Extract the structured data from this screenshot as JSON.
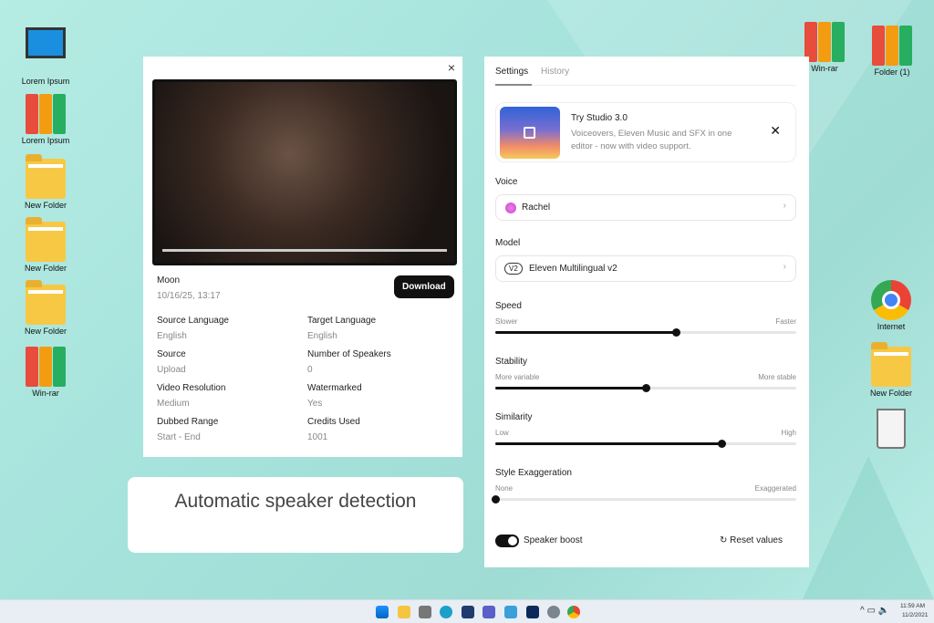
{
  "desktop": {
    "left_icons": [
      "Lorem Ipsum",
      "Lorem Ipsum",
      "New Folder",
      "New Folder",
      "New Folder",
      "Win-rar"
    ],
    "right_icons": [
      "Win-rar",
      "Folder (1)",
      "Internet",
      "New Folder"
    ]
  },
  "dub": {
    "title": "Moon",
    "date": "10/16/25, 13:17",
    "download": "Download",
    "fields": [
      {
        "label": "Source Language",
        "value": "English"
      },
      {
        "label": "Target Language",
        "value": "English"
      },
      {
        "label": "Source",
        "value": "Upload"
      },
      {
        "label": "Number of Speakers",
        "value": "0"
      },
      {
        "label": "Video Resolution",
        "value": "Medium"
      },
      {
        "label": "Watermarked",
        "value": "Yes"
      },
      {
        "label": "Dubbed Range",
        "value": "Start - End"
      },
      {
        "label": "Credits Used",
        "value": "1001"
      }
    ],
    "close": "×"
  },
  "settings": {
    "tabs": [
      "Settings",
      "History"
    ],
    "promo": {
      "title": "Try Studio 3.0",
      "desc": "Voiceovers, Eleven Music and SFX in one editor - now with video support."
    },
    "voice_label": "Voice",
    "voice": "Rachel",
    "model_label": "Model",
    "model_badge": "V2",
    "model": "Eleven Multilingual v2",
    "sliders": [
      {
        "label": "Speed",
        "min": "Slower",
        "max": "Faster",
        "value": 0.6
      },
      {
        "label": "Stability",
        "min": "More variable",
        "max": "More stable",
        "value": 0.5
      },
      {
        "label": "Similarity",
        "min": "Low",
        "max": "High",
        "value": 0.75
      },
      {
        "label": "Style Exaggeration",
        "min": "None",
        "max": "Exaggerated",
        "value": 0
      }
    ],
    "speaker_boost": "Speaker boost",
    "speaker_boost_on": true,
    "reset": "Reset values"
  },
  "caption": "Automatic speaker detection",
  "taskbar": {
    "time": "11:59 AM",
    "date": "11/2/2021"
  }
}
